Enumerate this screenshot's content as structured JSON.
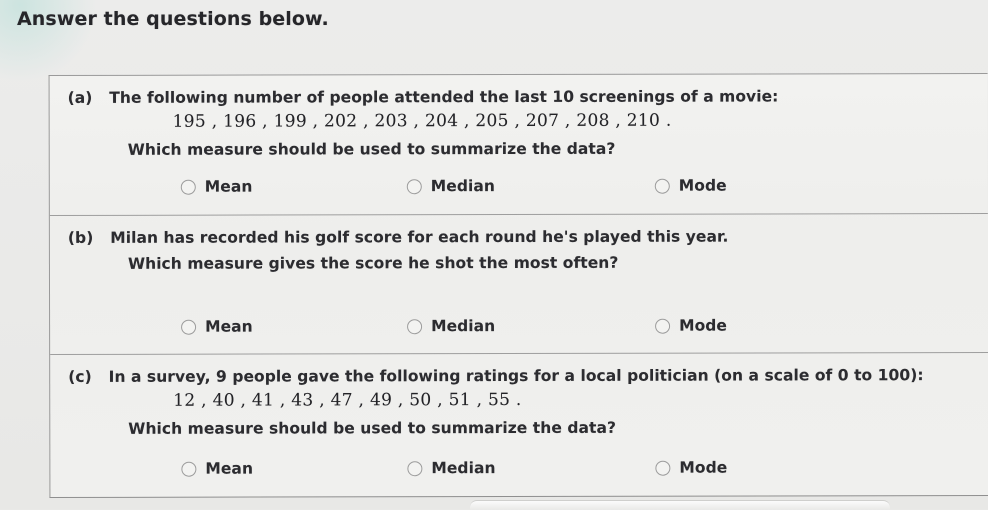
{
  "prompt": "Answer the questions below.",
  "questions": [
    {
      "id": "a",
      "label": "(a)",
      "line1": "The following number of people attended the last 10 screenings of a movie:",
      "numbers": "195 , 196 , 199 , 202 , 203 , 204 , 205 , 207 , 208 , 210 .",
      "line2": "Which measure should be used to summarize the data?",
      "options": [
        {
          "name": "mean",
          "label": "Mean",
          "selected": false
        },
        {
          "name": "median",
          "label": "Median",
          "selected": false
        },
        {
          "name": "mode",
          "label": "Mode",
          "selected": false
        }
      ]
    },
    {
      "id": "b",
      "label": "(b)",
      "line1": "Milan has recorded his golf score for each round he's played this year.",
      "numbers": "",
      "line2": "Which measure gives the score he shot the most often?",
      "options": [
        {
          "name": "mean",
          "label": "Mean",
          "selected": false
        },
        {
          "name": "median",
          "label": "Median",
          "selected": false
        },
        {
          "name": "mode",
          "label": "Mode",
          "selected": false
        }
      ]
    },
    {
      "id": "c",
      "label": "(c)",
      "line1": "In a survey, 9 people gave the following ratings for a local politician (on a scale of 0 to 100):",
      "numbers": "12 , 40 , 41 , 43 , 47 , 49 , 50 , 51 , 55 .",
      "line2": "Which measure should be used to summarize the data?",
      "options": [
        {
          "name": "mean",
          "label": "Mean",
          "selected": false
        },
        {
          "name": "median",
          "label": "Median",
          "selected": false
        },
        {
          "name": "mode",
          "label": "Mode",
          "selected": false
        }
      ]
    }
  ],
  "colors": {
    "page_background": "#e9e9e7",
    "card_background": "#f0f0ee",
    "border": "#9a9a9a",
    "text": "#2c2c30",
    "radio_outline": "#9c9c9c"
  }
}
